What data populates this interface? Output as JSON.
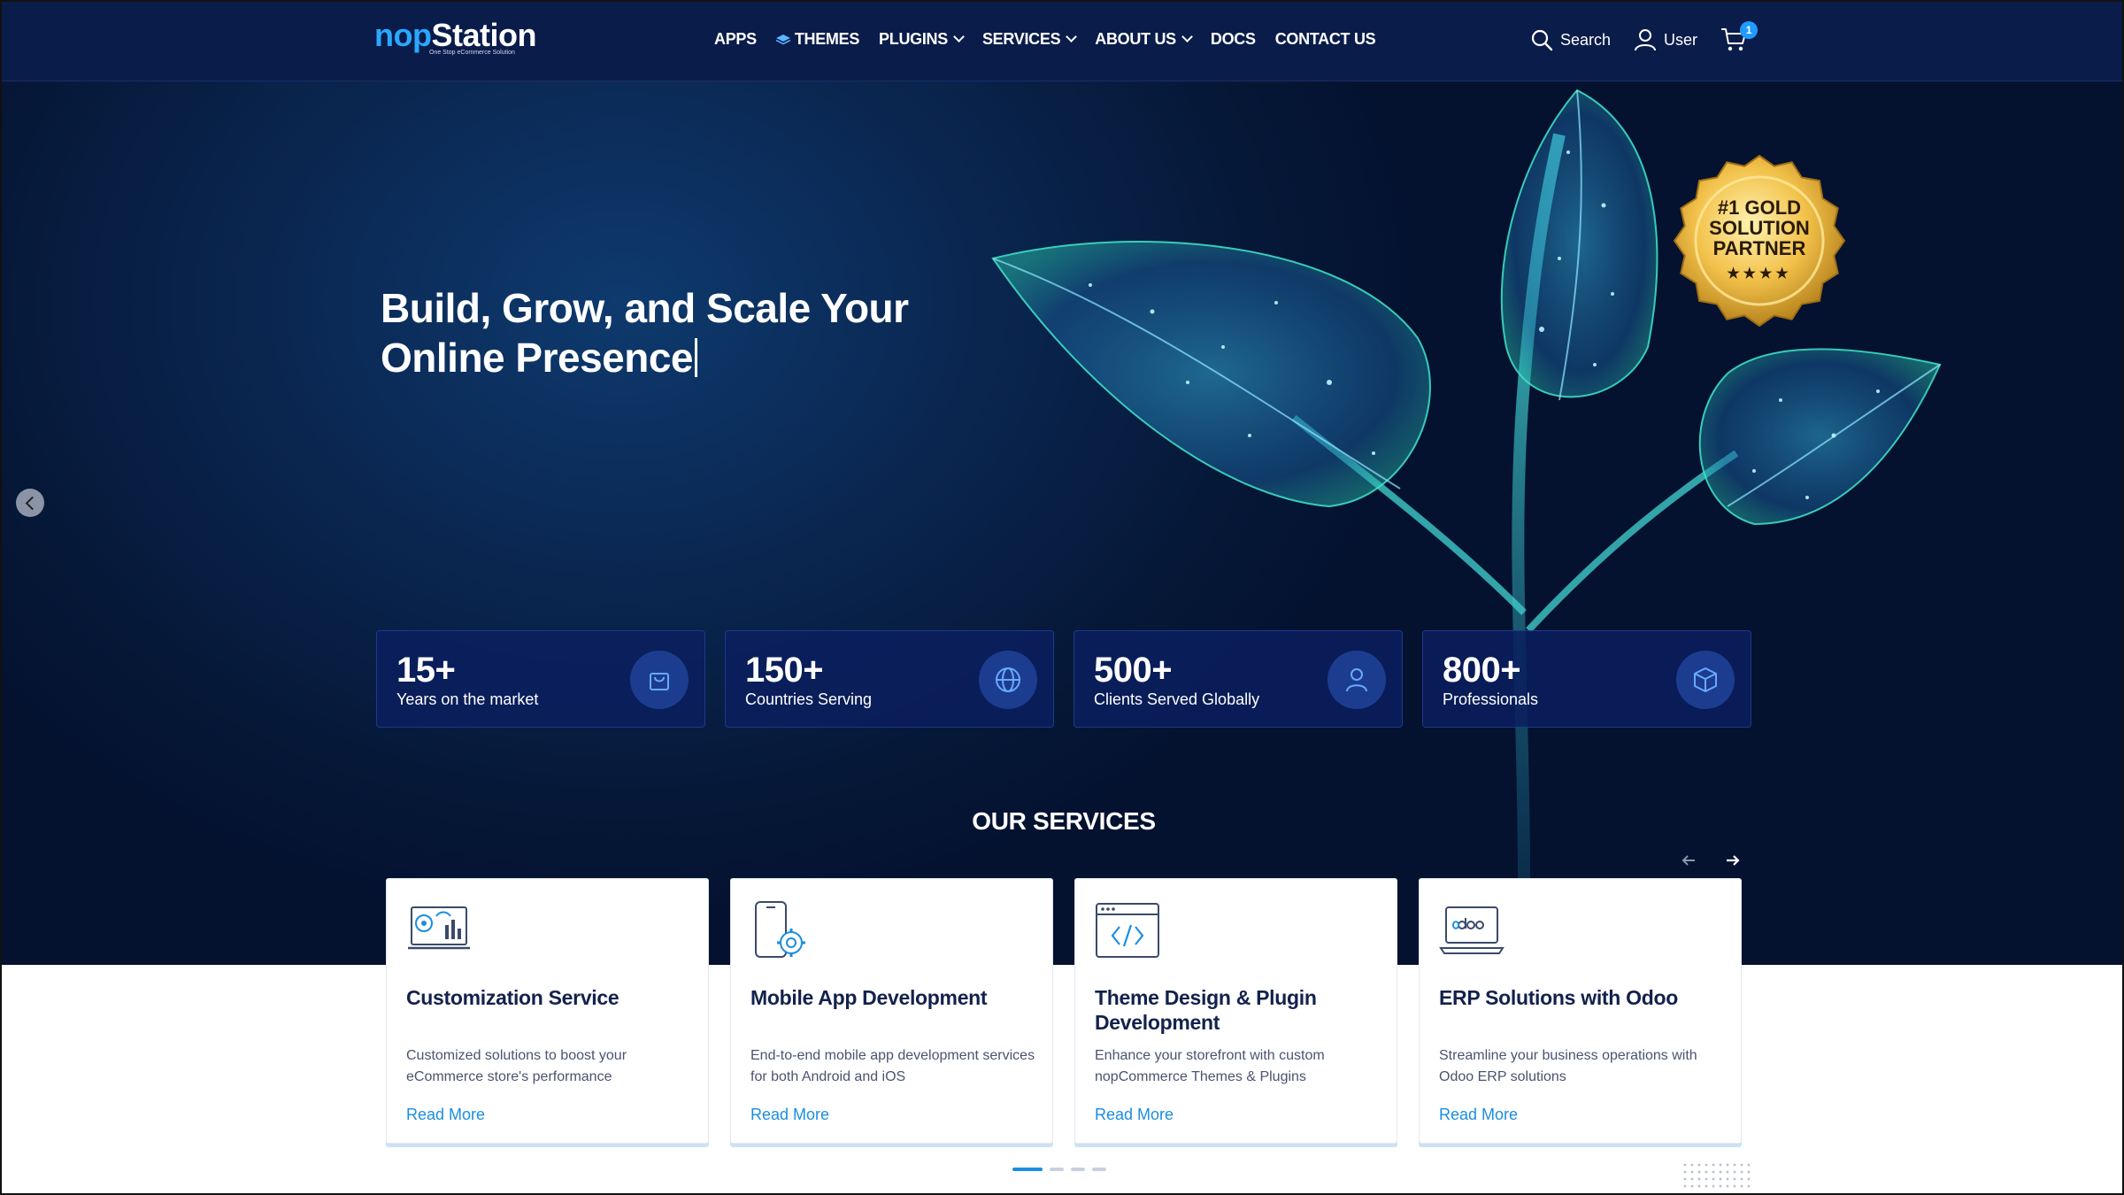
{
  "header": {
    "logo": {
      "nop": "nop",
      "station": "Station",
      "tagline": "One Stop eCommerce Solution"
    },
    "nav": [
      {
        "label": "APPS",
        "dropdown": false
      },
      {
        "label": "THEMES",
        "dropdown": false
      },
      {
        "label": "PLUGINS",
        "dropdown": true
      },
      {
        "label": "SERVICES",
        "dropdown": true
      },
      {
        "label": "ABOUT US",
        "dropdown": true
      },
      {
        "label": "DOCS",
        "dropdown": false
      },
      {
        "label": "CONTACT US",
        "dropdown": false
      }
    ],
    "search_label": "Search",
    "user_label": "User",
    "cart_count": "1"
  },
  "hero": {
    "title_line1": "Build, Grow, and Scale Your",
    "title_line2": "Online Presence",
    "badge": {
      "line1": "#1 GOLD",
      "line2": "SOLUTION",
      "line3": "PARTNER",
      "stars": "★★★★"
    }
  },
  "stats": [
    {
      "value": "15+",
      "label": "Years on the market",
      "icon": "shopping-bag-icon"
    },
    {
      "value": "150+",
      "label": "Countries Serving",
      "icon": "globe-icon"
    },
    {
      "value": "500+",
      "label": "Clients Served Globally",
      "icon": "user-icon"
    },
    {
      "value": "800+",
      "label": "Professionals",
      "icon": "cube-icon"
    }
  ],
  "services": {
    "title": "OUR SERVICES",
    "cards": [
      {
        "title": "Customization Service",
        "desc": "Customized solutions to boost your eCommerce store's performance",
        "link": "Read More",
        "icon": "customization-icon"
      },
      {
        "title": "Mobile App Development",
        "desc": "End-to-end mobile app development services for both Android and iOS",
        "link": "Read More",
        "icon": "mobile-gear-icon"
      },
      {
        "title": "Theme Design & Plugin Development",
        "desc": "Enhance your storefront with custom nopCommerce Themes & Plugins",
        "link": "Read More",
        "icon": "code-window-icon"
      },
      {
        "title": "ERP Solutions with Odoo",
        "desc": "Streamline your business operations with Odoo ERP solutions",
        "link": "Read More",
        "icon": "odoo-laptop-icon"
      }
    ]
  },
  "colors": {
    "header_bg": "#0a1c4a",
    "accent": "#1a8ee0",
    "stat_bg": "#0a1e5f"
  }
}
